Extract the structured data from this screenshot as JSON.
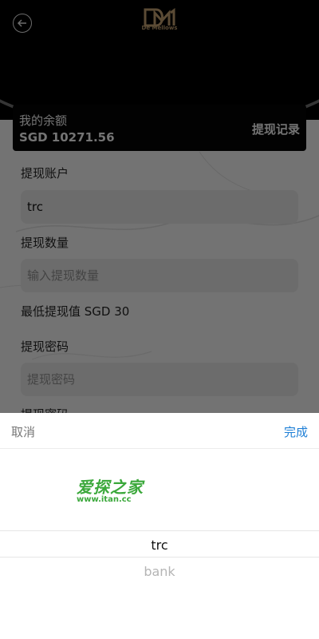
{
  "header": {
    "logo_text": "De Mellows"
  },
  "balance": {
    "label": "我的余额",
    "value": "SGD 10271.56",
    "history_link": "提现记录"
  },
  "form": {
    "account_label": "提现账户",
    "account_value": "trc",
    "amount_label": "提现数量",
    "amount_placeholder": "输入提现数量",
    "min_label": "最低提现值 SGD 30",
    "password_label": "提现密码",
    "password_placeholder": "提现密码",
    "password2_label": "提现密码"
  },
  "picker": {
    "cancel": "取消",
    "done": "完成",
    "options": [
      "trc",
      "bank"
    ],
    "selected": "trc",
    "watermark_main": "爱探之家",
    "watermark_sub": "www.itan.cc"
  }
}
